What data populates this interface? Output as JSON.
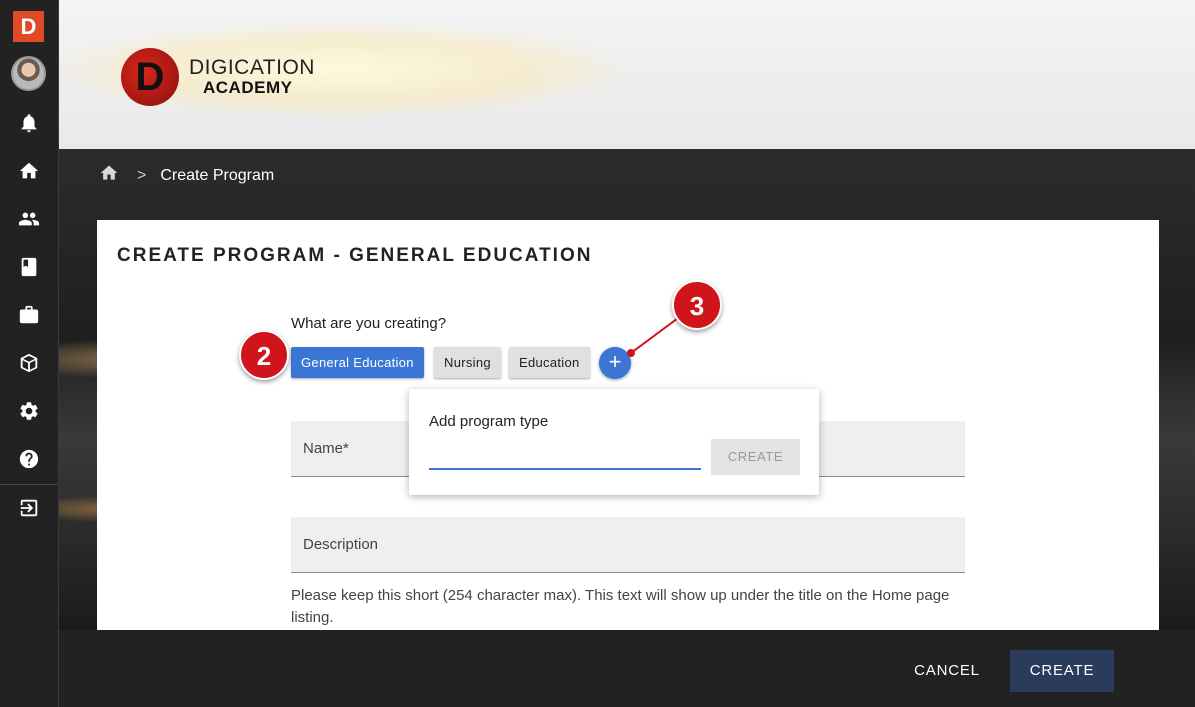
{
  "app": {
    "logo_letter": "D"
  },
  "brand": {
    "mark_letter": "D",
    "line1": "DIGICATION",
    "line2": "ACADEMY"
  },
  "rail": {
    "icons": [
      "bell-icon",
      "home-icon",
      "people-icon",
      "book-icon",
      "briefcase-icon",
      "box-icon",
      "gear-icon",
      "help-icon",
      "logout-icon"
    ]
  },
  "breadcrumb": {
    "separator": ">",
    "current": "Create Program"
  },
  "card": {
    "title": "CREATE PROGRAM - GENERAL EDUCATION",
    "question": "What are you creating?",
    "chips": [
      {
        "label": "General Education",
        "active": true
      },
      {
        "label": "Nursing",
        "active": false
      },
      {
        "label": "Education",
        "active": false
      }
    ],
    "add_button": "+",
    "name_label": "Name*",
    "description_label": "Description",
    "helper_text": "Please keep this short (254 character max). This text will show up under the title on the Home page listing."
  },
  "popover": {
    "title": "Add program type",
    "input_value": "",
    "create_label": "CREATE"
  },
  "callouts": {
    "step2": "2",
    "step3": "3"
  },
  "footer": {
    "cancel_label": "CANCEL",
    "create_label": "CREATE"
  },
  "colors": {
    "accent": "#3b76d4",
    "callout": "#d0141b",
    "primary_button": "#2a3b5c",
    "logo": "#e04b25"
  }
}
